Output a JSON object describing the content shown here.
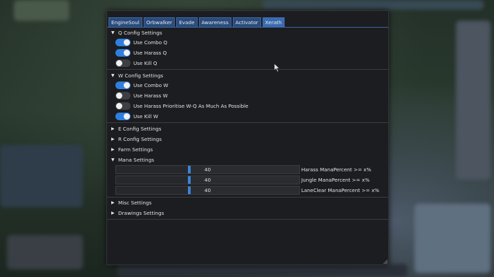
{
  "colors": {
    "accent": "#2f7fde",
    "tab_bg": "#2a4b7c",
    "panel_bg": "#1c1d20"
  },
  "tabs": [
    "EngineSoul",
    "Orbwalker",
    "Evade",
    "Awareness",
    "Activator",
    "Xerath"
  ],
  "active_tab": "Xerath",
  "q_section": {
    "label": "Q Config Settings",
    "expanded": true,
    "toggles": [
      {
        "label": "Use Combo Q",
        "on": true
      },
      {
        "label": "Use Harass Q",
        "on": true
      },
      {
        "label": "Use Kill Q",
        "on": false
      }
    ]
  },
  "w_section": {
    "label": "W Config Settings",
    "expanded": true,
    "toggles": [
      {
        "label": "Use Combo W",
        "on": true
      },
      {
        "label": "Use Harass W",
        "on": false
      },
      {
        "label": "Use Harass Prioritise W-Q As Much As Possible",
        "on": false
      },
      {
        "label": "Use Kill W",
        "on": true
      }
    ]
  },
  "collapsed_sections": [
    "E Config Settings",
    "R Config Settings",
    "Farm Settings"
  ],
  "mana_section": {
    "label": "Mana Settings",
    "expanded": true,
    "sliders": [
      {
        "label": "Harass ManaPercent >= x%",
        "value": "40",
        "fraction": 0.4
      },
      {
        "label": "Jungle ManaPercent >= x%",
        "value": "40",
        "fraction": 0.4
      },
      {
        "label": "LaneClear ManaPercent >= x%",
        "value": "40",
        "fraction": 0.4
      }
    ]
  },
  "bottom_sections": [
    "Misc Settings",
    "Drawings Settings"
  ],
  "icons": {
    "expanded": "triangle-down-icon",
    "collapsed": "triangle-right-icon",
    "resize": "resize-grip-icon",
    "cursor": "mouse-cursor-icon"
  }
}
